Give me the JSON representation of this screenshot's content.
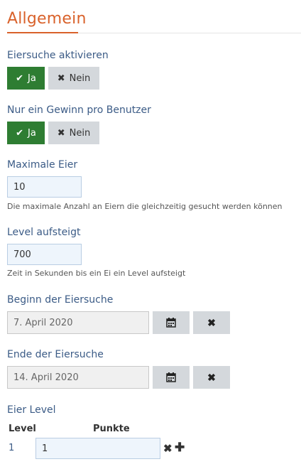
{
  "section": {
    "title": "Allgemein"
  },
  "egg_search": {
    "label": "Eiersuche aktivieren",
    "yes_label": "Ja",
    "no_label": "Nein"
  },
  "one_win": {
    "label": "Nur ein Gewinn pro Benutzer",
    "yes_label": "Ja",
    "no_label": "Nein"
  },
  "max_eggs": {
    "label": "Maximale Eier",
    "value": "10",
    "help": "Die maximale Anzahl an Eiern die gleichzeitig gesucht werden können"
  },
  "level_up": {
    "label": "Level aufsteigt",
    "value": "700",
    "help": "Zeit in Sekunden bis ein Ei ein Level aufsteigt"
  },
  "start_date": {
    "label": "Beginn der Eiersuche",
    "value": "7. April 2020"
  },
  "end_date": {
    "label": "Ende der Eiersuche",
    "value": "14. April 2020"
  },
  "egg_level": {
    "label": "Eier Level",
    "columns": [
      "Level",
      "Punkte"
    ],
    "rows": [
      {
        "level": "1",
        "points": "1"
      }
    ]
  },
  "icons": {
    "check": "check-icon",
    "times": "times-icon",
    "calendar": "calendar-icon",
    "plus": "plus-icon"
  },
  "colors": {
    "title": "#d9622b",
    "label": "#3b5b86",
    "yes_button": "#2e7d32",
    "no_button": "#d4d8dc"
  }
}
